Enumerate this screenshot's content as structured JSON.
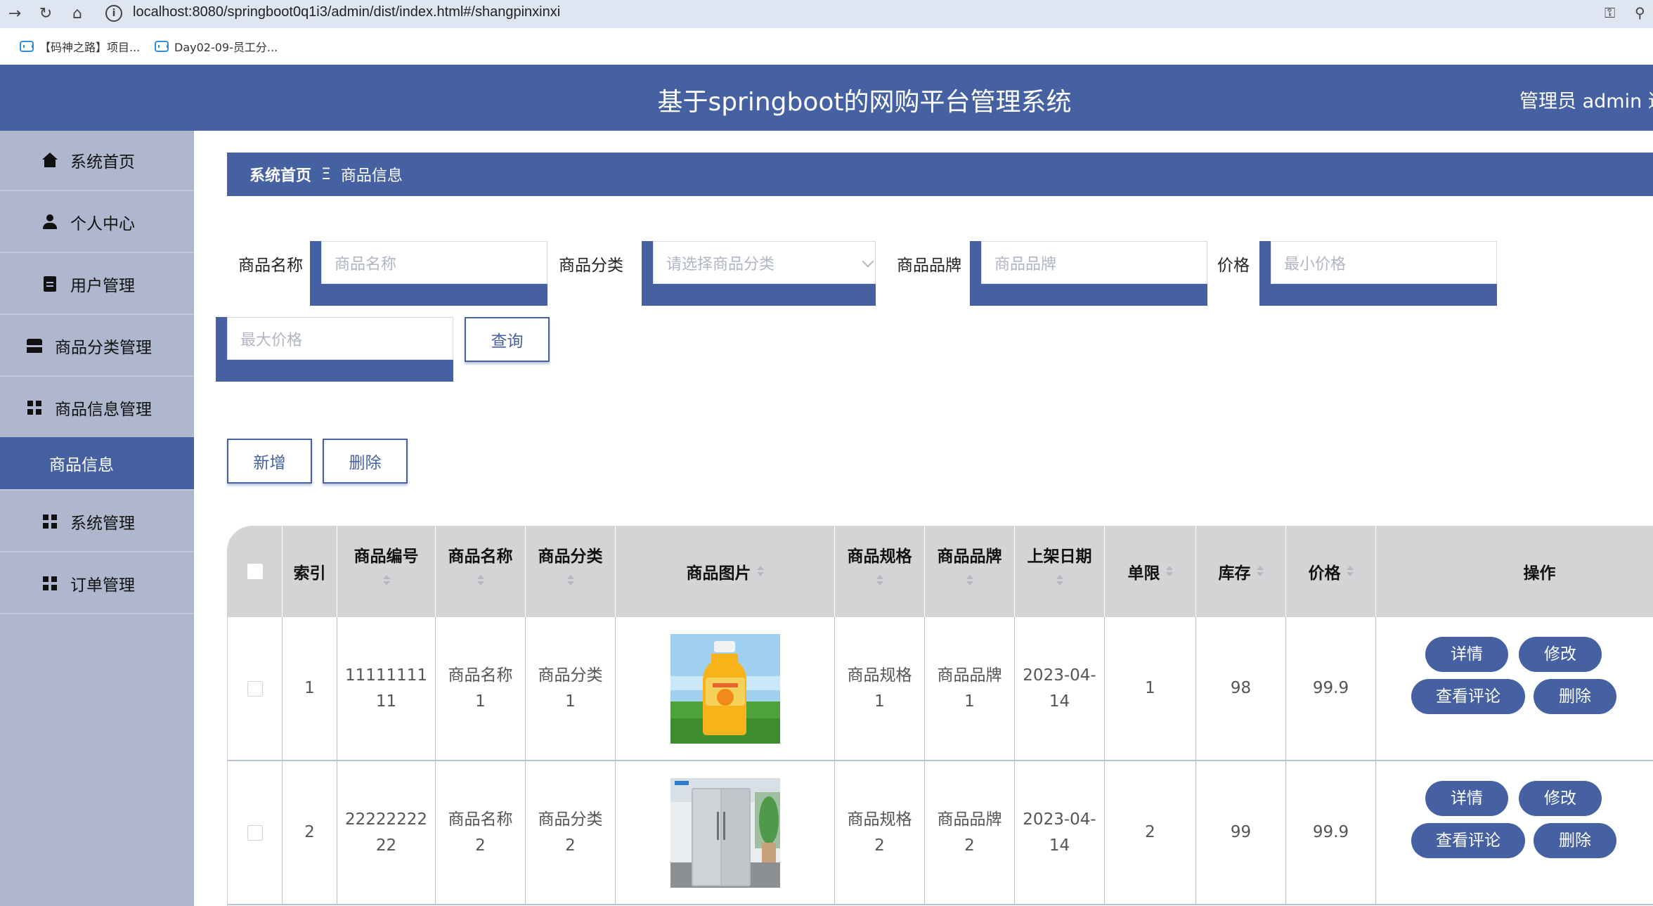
{
  "browser": {
    "url": "localhost:8080/springboot0q1i3/admin/dist/index.html#/shangpinxinxi",
    "bookmarks": [
      "【码神之路】项目...",
      "Day02-09-员工分..."
    ]
  },
  "header": {
    "title": "基于springboot的网购平台管理系统",
    "user": "管理员 admin  退"
  },
  "sidebar": {
    "items": [
      {
        "label": "系统首页",
        "icon": "home-icon"
      },
      {
        "label": "个人中心",
        "icon": "user-icon"
      },
      {
        "label": "用户管理",
        "icon": "clipboard-icon"
      },
      {
        "label": "商品分类管理",
        "icon": "store-icon"
      },
      {
        "label": "商品信息管理",
        "icon": "grid-icon"
      },
      {
        "label": "商品信息",
        "icon": ""
      },
      {
        "label": "系统管理",
        "icon": "grid-icon"
      },
      {
        "label": "订单管理",
        "icon": "grid-icon"
      }
    ],
    "active_index": 5
  },
  "breadcrumb": {
    "home": "系统首页",
    "separator": "Ξ",
    "current": "商品信息"
  },
  "filters": {
    "name": {
      "label": "商品名称",
      "placeholder": "商品名称"
    },
    "category": {
      "label": "商品分类",
      "placeholder": "请选择商品分类"
    },
    "brand": {
      "label": "商品品牌",
      "placeholder": "商品品牌"
    },
    "price": {
      "label": "价格",
      "min_placeholder": "最小价格",
      "max_placeholder": "最大价格"
    },
    "query_label": "查询"
  },
  "actions": {
    "add_label": "新增",
    "delete_label": "删除"
  },
  "table": {
    "headers": [
      "索引",
      "商品编号",
      "商品名称",
      "商品分类",
      "商品图片",
      "商品规格",
      "商品品牌",
      "上架日期",
      "单限",
      "库存",
      "价格",
      "操作"
    ],
    "rows": [
      {
        "index": "1",
        "code": [
          "11111111",
          "11"
        ],
        "name": [
          "商品名称",
          "1"
        ],
        "category": [
          "商品分类",
          "1"
        ],
        "image": "mango-juice-bottle",
        "spec": [
          "商品规格",
          "1"
        ],
        "brand": [
          "商品品牌",
          "1"
        ],
        "date": [
          "2023-04-",
          "14"
        ],
        "limit": "1",
        "stock": "98",
        "price": "99.9"
      },
      {
        "index": "2",
        "code": [
          "22222222",
          "22"
        ],
        "name": [
          "商品名称",
          "2"
        ],
        "category": [
          "商品分类",
          "2"
        ],
        "image": "refrigerator",
        "spec": [
          "商品规格",
          "2"
        ],
        "brand": [
          "商品品牌",
          "2"
        ],
        "date": [
          "2023-04-",
          "14"
        ],
        "limit": "2",
        "stock": "99",
        "price": "99.9"
      }
    ],
    "row_buttons": {
      "detail": "详情",
      "edit": "修改",
      "reviews": "查看评论",
      "delete": "删除"
    }
  },
  "colors": {
    "primary": "#4661a2",
    "sidebar_bg": "#aeb7cd",
    "table_header_bg": "#d4d4d6"
  }
}
